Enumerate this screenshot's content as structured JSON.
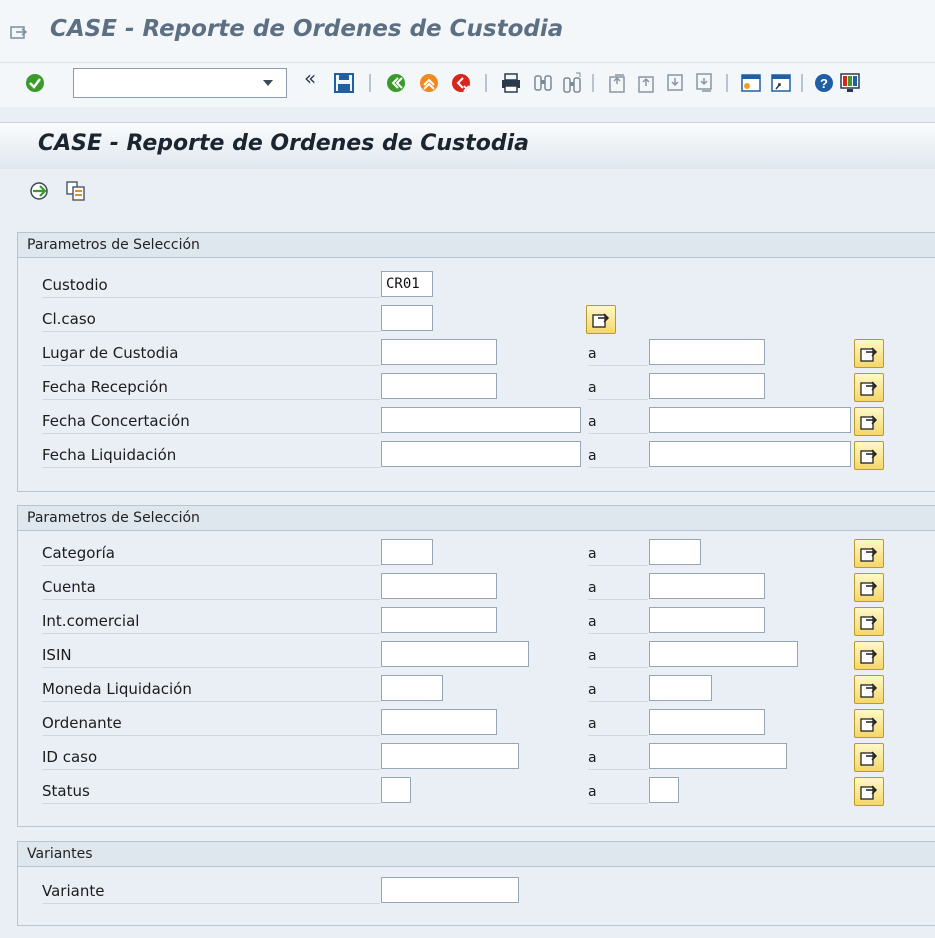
{
  "window": {
    "title": "CASE - Reporte de Ordenes de Custodia"
  },
  "toolbar": {
    "command_field_value": "",
    "buttons": [
      "enter-icon",
      "back-arrows-icon",
      "save-icon",
      "back-icon",
      "exit-icon",
      "cancel-icon",
      "print-icon",
      "find-icon",
      "find-next-icon",
      "first-page-icon",
      "previous-page-icon",
      "next-page-icon",
      "last-page-icon",
      "create-session-icon",
      "shortcut-icon",
      "help-icon",
      "customize-layout-icon"
    ]
  },
  "page": {
    "title": "CASE - Reporte de Ordenes de Custodia",
    "app_buttons": [
      "execute-icon",
      "get-variant-icon"
    ]
  },
  "group1": {
    "title": "Parametros de Selección",
    "rows": [
      {
        "label": "Custodio",
        "from": "CR01"
      },
      {
        "label": "Cl.caso",
        "from": ""
      },
      {
        "label": "Lugar de Custodia",
        "from": "",
        "to_label": "a",
        "to": ""
      },
      {
        "label": "Fecha Recepción",
        "from": "",
        "to_label": "a",
        "to": ""
      },
      {
        "label": "Fecha Concertación",
        "from": "",
        "to_label": "a",
        "to": ""
      },
      {
        "label": "Fecha Liquidación",
        "from": "",
        "to_label": "a",
        "to": ""
      }
    ]
  },
  "group2": {
    "title": "Parametros de Selección",
    "rows": [
      {
        "label": "Categoría",
        "from": "",
        "to_label": "a",
        "to": ""
      },
      {
        "label": "Cuenta",
        "from": "",
        "to_label": "a",
        "to": ""
      },
      {
        "label": "Int.comercial",
        "from": "",
        "to_label": "a",
        "to": ""
      },
      {
        "label": "ISIN",
        "from": "",
        "to_label": "a",
        "to": ""
      },
      {
        "label": "Moneda Liquidación",
        "from": "",
        "to_label": "a",
        "to": ""
      },
      {
        "label": "Ordenante",
        "from": "",
        "to_label": "a",
        "to": ""
      },
      {
        "label": "ID caso",
        "from": "",
        "to_label": "a",
        "to": ""
      },
      {
        "label": "Status",
        "from": "",
        "to_label": "a",
        "to": ""
      }
    ]
  },
  "group3": {
    "title": "Variantes",
    "rows": [
      {
        "label": "Variante",
        "from": ""
      }
    ]
  },
  "colors": {
    "background": "#e9eff5",
    "title_text": "#5c6f83",
    "multi_button": "#f5d768"
  }
}
